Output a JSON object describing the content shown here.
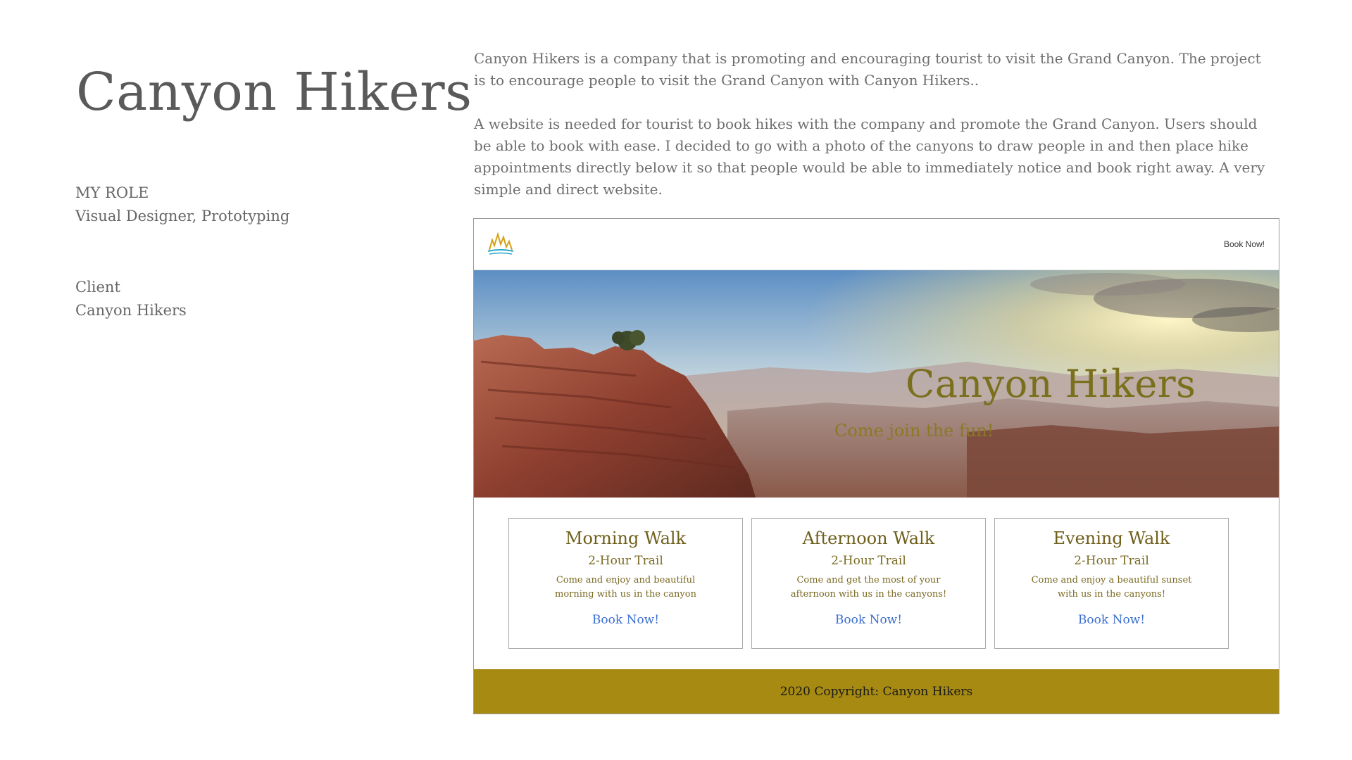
{
  "project": {
    "title": "Canyon Hikers",
    "role_label": "MY ROLE",
    "role_value": "Visual Designer, Prototyping",
    "client_label": "Client",
    "client_value": "Canyon Hikers"
  },
  "intro": {
    "paragraph_1": "Canyon Hikers is a company that is promoting and encouraging tourist to visit the Grand Canyon. The project is to encourage people to visit the Grand Canyon with Canyon Hikers..",
    "paragraph_2": "A website is needed for tourist to book hikes with the company and promote the Grand Canyon. Users should be able to book with ease. I decided to go with a photo of the canyons to draw people in and then place hike appointments directly below it so that people would be able to immediately notice and book right away. A very simple and direct website."
  },
  "mockup": {
    "nav": {
      "book_label": "Book Now!",
      "logo_icon": "canyon-logo-icon"
    },
    "hero": {
      "title": "Canyon Hikers",
      "subtitle": "Come join the fun!"
    },
    "cards": [
      {
        "title": "Morning Walk",
        "trail": "2-Hour Trail",
        "desc": "Come and enjoy and beautiful morning with us in the canyon",
        "book": "Book Now!"
      },
      {
        "title": "Afternoon Walk",
        "trail": "2-Hour Trail",
        "desc": "Come and get the most of your afternoon with us in the canyons!",
        "book": "Book Now!"
      },
      {
        "title": "Evening Walk",
        "trail": "2-Hour Trail",
        "desc": "Come and enjoy a beautiful sunset with us in the canyons!",
        "book": "Book Now!"
      }
    ],
    "footer": "2020 Copyright: Canyon Hikers"
  },
  "colors": {
    "footer": "#a68a12",
    "book_link": "#3b6fd1",
    "hero_title": "#7a6f1c"
  }
}
